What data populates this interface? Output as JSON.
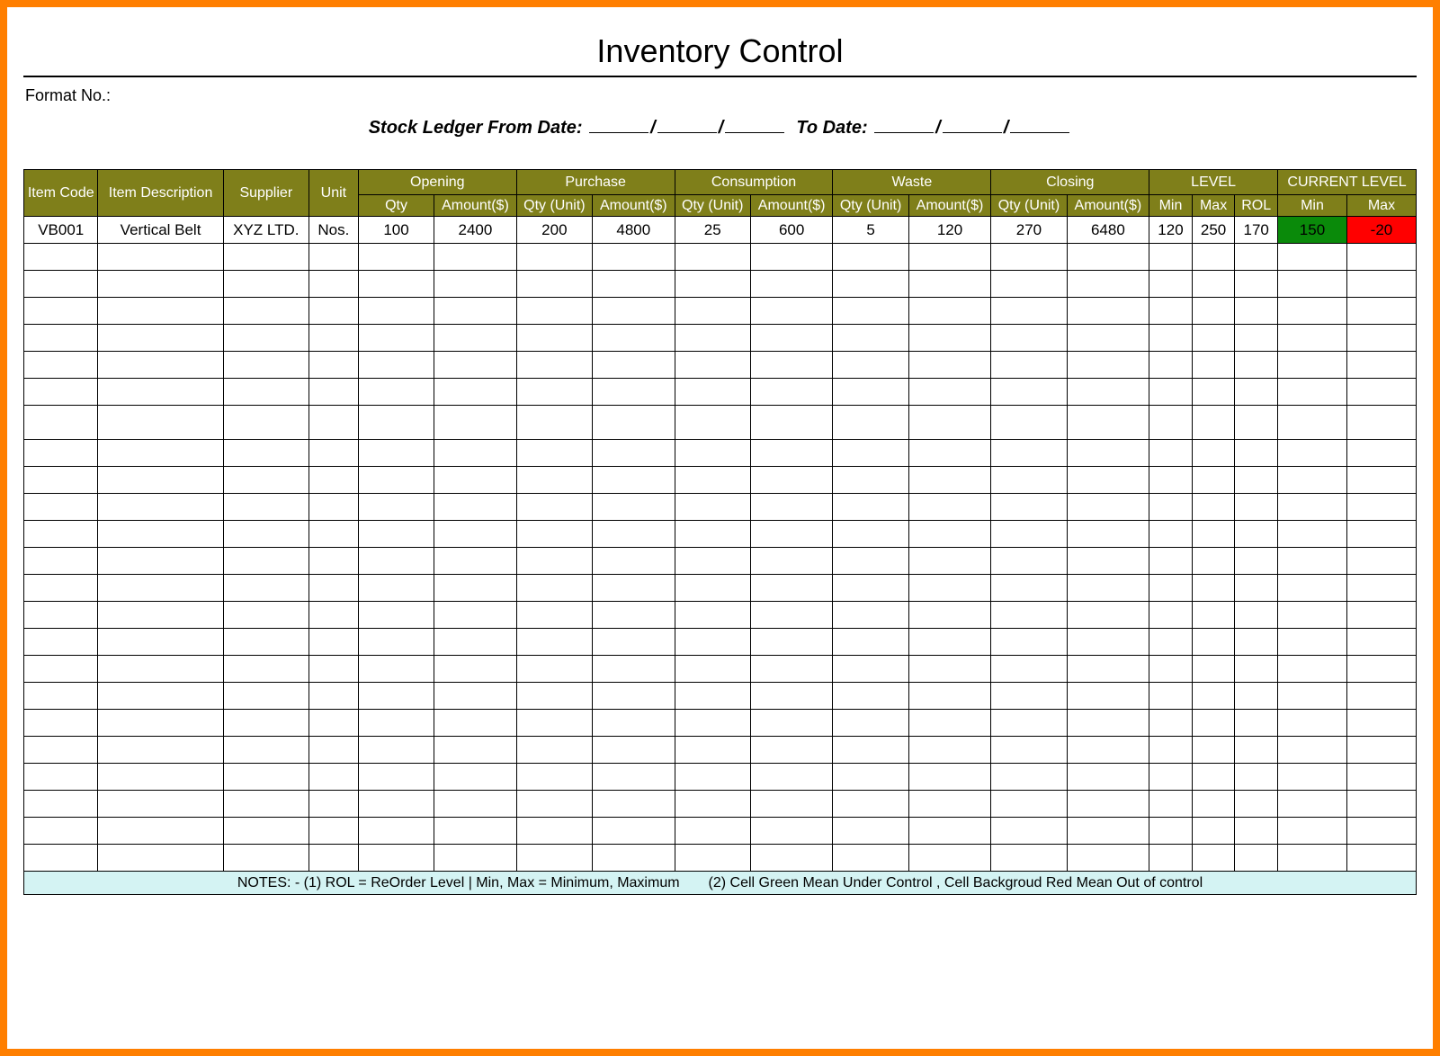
{
  "title": "Inventory Control",
  "format_label": "Format No.:",
  "date_line": {
    "ledger_from_label": "Stock Ledger From Date:",
    "to_label": "To Date:"
  },
  "headers": {
    "item_code": "Item Code",
    "item_desc": "Item Description",
    "supplier": "Supplier",
    "unit": "Unit",
    "groups": {
      "opening": "Opening",
      "purchase": "Purchase",
      "consumption": "Consumption",
      "waste": "Waste",
      "closing": "Closing",
      "level": "LEVEL",
      "current": "CURRENT LEVEL"
    },
    "sub": {
      "qty": "Qty",
      "amount": "Amount($)",
      "qty_unit": "Qty (Unit)",
      "min": "Min",
      "max": "Max",
      "rol": "ROL"
    }
  },
  "rows": [
    {
      "item_code": "VB001",
      "item_desc": "Vertical Belt",
      "supplier": "XYZ LTD.",
      "unit": "Nos.",
      "opening_qty": "100",
      "opening_amt": "2400",
      "purchase_qty": "200",
      "purchase_amt": "4800",
      "consumption_qty": "25",
      "consumption_amt": "600",
      "waste_qty": "5",
      "waste_amt": "120",
      "closing_qty": "270",
      "closing_amt": "6480",
      "level_min": "120",
      "level_max": "250",
      "level_rol": "170",
      "current_min": "150",
      "current_max": "-20",
      "current_min_status": "ok",
      "current_max_status": "out"
    }
  ],
  "empty_row_count": 23,
  "notes": "NOTES: - (1) ROL = ReOrder Level | Min, Max = Minimum, Maximum  (2) Cell Green Mean Under Control , Cell Backgroud Red Mean Out of control",
  "colors": {
    "frame_border": "#ff7f00",
    "header_bg": "#7f7f1a",
    "ok_bg": "#0a8a0a",
    "out_bg": "#ff0000",
    "notes_bg": "#d4f3f3"
  }
}
